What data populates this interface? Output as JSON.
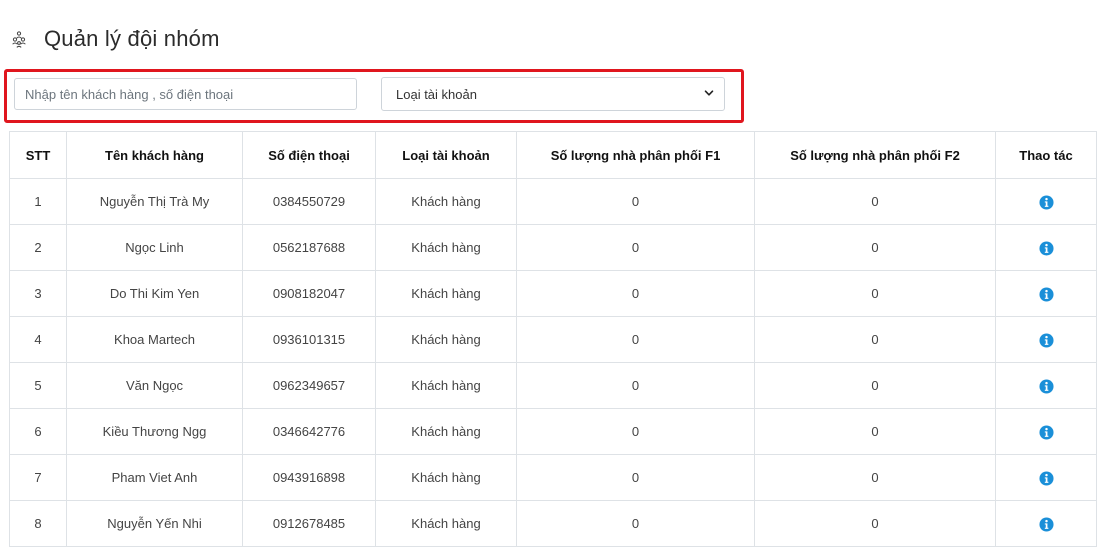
{
  "header": {
    "title": "Quản lý đội nhóm",
    "icon": "team-icon"
  },
  "filters": {
    "search_placeholder": "Nhập tên khách hàng , số điện thoại",
    "search_value": "",
    "account_type_selected": "Loại tài khoản"
  },
  "table": {
    "columns": [
      "STT",
      "Tên khách hàng",
      "Số điện thoại",
      "Loại tài khoản",
      "Số lượng nhà phân phối F1",
      "Số lượng nhà phân phối F2",
      "Thao tác"
    ],
    "rows": [
      {
        "stt": "1",
        "name": "Nguyễn Thị Trà My",
        "phone": "0384550729",
        "type": "Khách hàng",
        "f1": "0",
        "f2": "0"
      },
      {
        "stt": "2",
        "name": "Ngọc Linh",
        "phone": "0562187688",
        "type": "Khách hàng",
        "f1": "0",
        "f2": "0"
      },
      {
        "stt": "3",
        "name": "Do Thi Kim Yen",
        "phone": "0908182047",
        "type": "Khách hàng",
        "f1": "0",
        "f2": "0"
      },
      {
        "stt": "4",
        "name": "Khoa Martech",
        "phone": "0936101315",
        "type": "Khách hàng",
        "f1": "0",
        "f2": "0"
      },
      {
        "stt": "5",
        "name": "Văn Ngọc",
        "phone": "0962349657",
        "type": "Khách hàng",
        "f1": "0",
        "f2": "0"
      },
      {
        "stt": "6",
        "name": "Kiều Thương Ngg",
        "phone": "0346642776",
        "type": "Khách hàng",
        "f1": "0",
        "f2": "0"
      },
      {
        "stt": "7",
        "name": "Pham Viet Anh",
        "phone": "0943916898",
        "type": "Khách hàng",
        "f1": "0",
        "f2": "0"
      },
      {
        "stt": "8",
        "name": "Nguyễn Yến Nhi",
        "phone": "0912678485",
        "type": "Khách hàng",
        "f1": "0",
        "f2": "0"
      }
    ],
    "action_icon": "info-icon"
  },
  "colors": {
    "highlight_border": "#e0161e",
    "info_icon": "#1a8fd8",
    "grid": "#dee2e6"
  }
}
